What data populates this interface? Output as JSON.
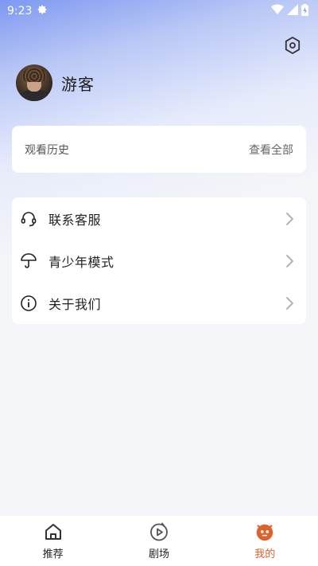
{
  "status_bar": {
    "time": "9:23",
    "icons": [
      "gear-icon",
      "wifi-icon",
      "signal-icon",
      "battery-icon"
    ]
  },
  "header": {
    "settings_icon": "hexagon-settings-icon",
    "username": "游客"
  },
  "history": {
    "title": "观看历史",
    "view_all": "查看全部"
  },
  "menu": {
    "items": [
      {
        "label": "联系客服",
        "icon": "headset-icon"
      },
      {
        "label": "青少年模式",
        "icon": "umbrella-icon"
      },
      {
        "label": "关于我们",
        "icon": "info-icon"
      }
    ]
  },
  "tabbar": {
    "tabs": [
      {
        "label": "推荐",
        "icon": "home-icon",
        "active": false
      },
      {
        "label": "剧场",
        "icon": "play-icon",
        "active": false
      },
      {
        "label": "我的",
        "icon": "mine-icon",
        "active": true
      }
    ],
    "active_color": "#e0622b"
  },
  "colors": {
    "gradient_top": "#7d98f0",
    "page_background": "#f4f5f9",
    "accent": "#e0622b"
  }
}
